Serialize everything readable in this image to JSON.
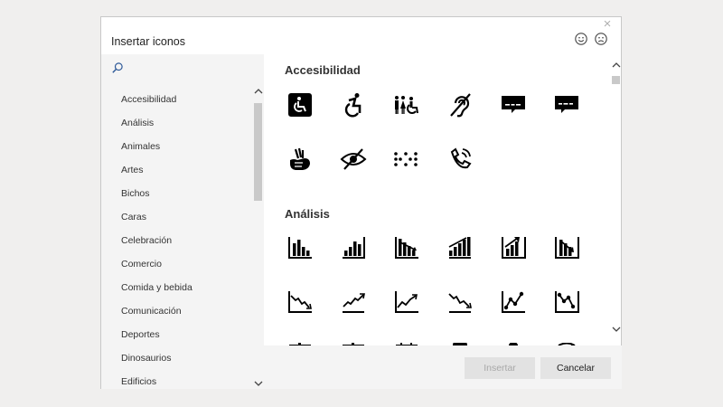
{
  "dialog": {
    "title": "Insertar iconos",
    "close_glyph": "×",
    "feedback_icons": [
      "smile-icon",
      "frown-icon"
    ]
  },
  "search": {
    "icon": "search-icon"
  },
  "categories": [
    "Accesibilidad",
    "Análisis",
    "Animales",
    "Artes",
    "Bichos",
    "Caras",
    "Celebración",
    "Comercio",
    "Comida y bebida",
    "Comunicación",
    "Deportes",
    "Dinosaurios",
    "Edificios"
  ],
  "sections": [
    {
      "title": "Accesibilidad",
      "icons": [
        "wheelchair-sign-icon",
        "active-wheelchair-icon",
        "family-accessible-icon",
        "hearing-impaired-icon",
        "closed-captioning-icon",
        "closed-captioning-alt-icon",
        "sign-language-icon",
        "low-vision-icon",
        "braille-icon",
        "phone-volume-icon"
      ]
    },
    {
      "title": "Análisis",
      "icons": [
        "bar-chart-down-icon",
        "bar-chart-up-icon",
        "bar-chart-trend-down-icon",
        "bar-chart-trend-up-icon",
        "bar-chart-arrow-up-icon",
        "bar-chart-arrow-down-icon",
        "line-chart-down-icon",
        "line-chart-up-icon",
        "line-chart-up-arrow-icon",
        "line-chart-down-arrow-icon",
        "scatter-chart-up-icon",
        "scatter-chart-down-icon"
      ]
    }
  ],
  "footer": {
    "insert_label": "Insertar",
    "cancel_label": "Cancelar"
  },
  "colors": {
    "icon": "#000000",
    "pane_bg": "#f4f4f4",
    "disabled_text": "#a8a8a8"
  }
}
